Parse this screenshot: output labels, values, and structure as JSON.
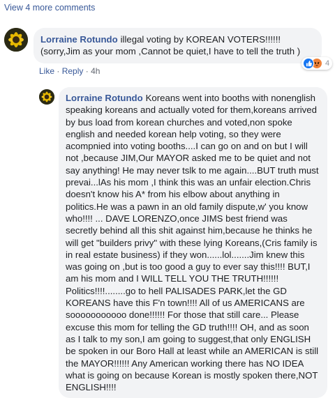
{
  "thread": {
    "view_more_label": "View 4 more comments"
  },
  "comments": [
    {
      "author": "Lorraine Rotundo",
      "text": "illegal voting by KOREAN VOTERS!!!!!! (sorry,Jim as your mom ,Cannot be quiet,I have to tell the truth )",
      "like_label": "Like",
      "reply_label": "Reply",
      "separator": "·",
      "timestamp": "4h",
      "reaction_count": "4",
      "reactions": [
        "like-icon",
        "angry-icon"
      ]
    },
    {
      "author": "Lorraine Rotundo",
      "text": "Koreans went into booths with nonenglish speaking koreans and actually voted for them,koreans arrived by bus load from korean churches and voted,non spoke english and needed korean help voting, so they were acompnied into voting booths....I can go on and on but I will not ,because JIM,Our MAYOR asked me to be quiet and not say anything! He may never tslk to me again....BUT truth must prevai...lAs his mom ,I think this was an unfair election.Chris doesn't know his A* from his elbow about anything in politics.He was a pawn in an old family dispute,w' you know who!!!! ... DAVE LORENZO,once JIMS best friend was secretly behind all this shit against him,because he thinks he will get \"builders privy\" with these lying Koreans,(Cris family is in real estate business) if they won......lol.......Jim knew this was going on ,but is too good a guy to ever say this!!!! BUT,I am his mom and I WILL TELL YOU THE TRUTH!!!!!! Politics!!!!........go to hell PALISADES PARK,let the GD KOREANS have this F'n town!!!! All of us AMERICANS are sooooooooooo done!!!!!! For those that still care... Please excuse this mom for telling the GD truth!!!! OH, and as soon as I talk to my son,I am going to suggest,that only ENGLISH be spoken in our Boro Hall at least while an AMERICAN is still the MAYOR!!!!!! Any American working there has NO IDEA what is going on because Korean is mostly spoken there,NOT ENGLISH!!!!"
    }
  ],
  "colors": {
    "link": "#385898",
    "bubble": "#f2f3f5",
    "like": "#1877f2",
    "angry": "#f0823a"
  }
}
